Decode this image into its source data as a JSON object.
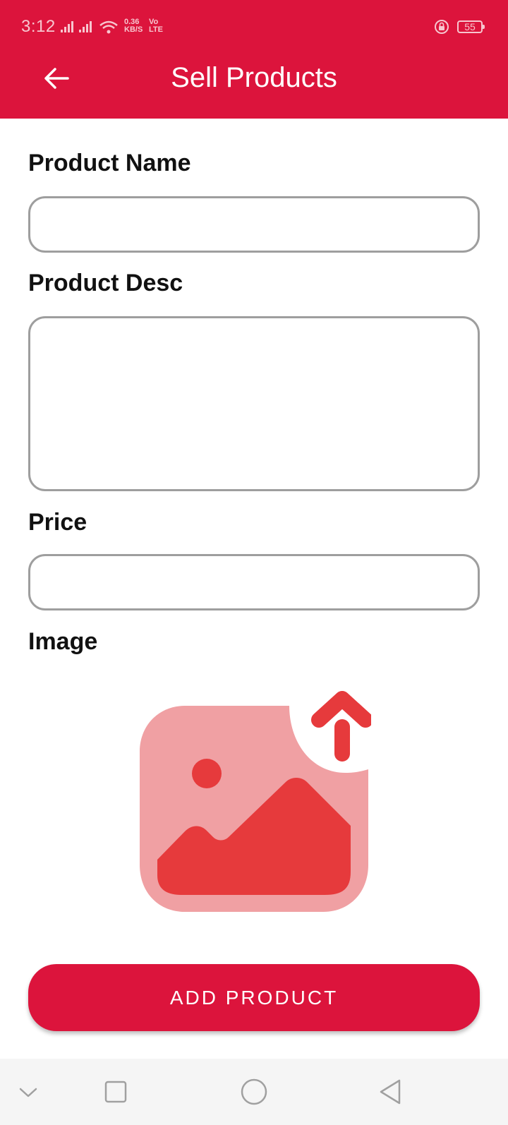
{
  "status_bar": {
    "time": "3:12",
    "net_speed_value": "0.36",
    "net_speed_unit": "KB/S",
    "net_type_top": "Vo",
    "net_type_bottom": "LTE",
    "battery": "55"
  },
  "header": {
    "title": "Sell Products",
    "back_icon": "arrow-left-icon"
  },
  "form": {
    "name_label": "Product Name",
    "name_value": "",
    "desc_label": "Product Desc",
    "desc_value": "",
    "price_label": "Price",
    "price_value": "",
    "image_label": "Image",
    "image_icon": "image-upload-icon"
  },
  "actions": {
    "add_label": "ADD PRODUCT"
  },
  "nav_bar": {
    "icons": [
      "chevron-down-icon",
      "square-icon",
      "circle-icon",
      "triangle-back-icon"
    ]
  },
  "colors": {
    "primary": "#dc143c",
    "input_border": "#9e9e9e",
    "image_light": "#f0a0a3",
    "image_dark": "#e63a3c",
    "nav_background": "#f5f5f5"
  }
}
